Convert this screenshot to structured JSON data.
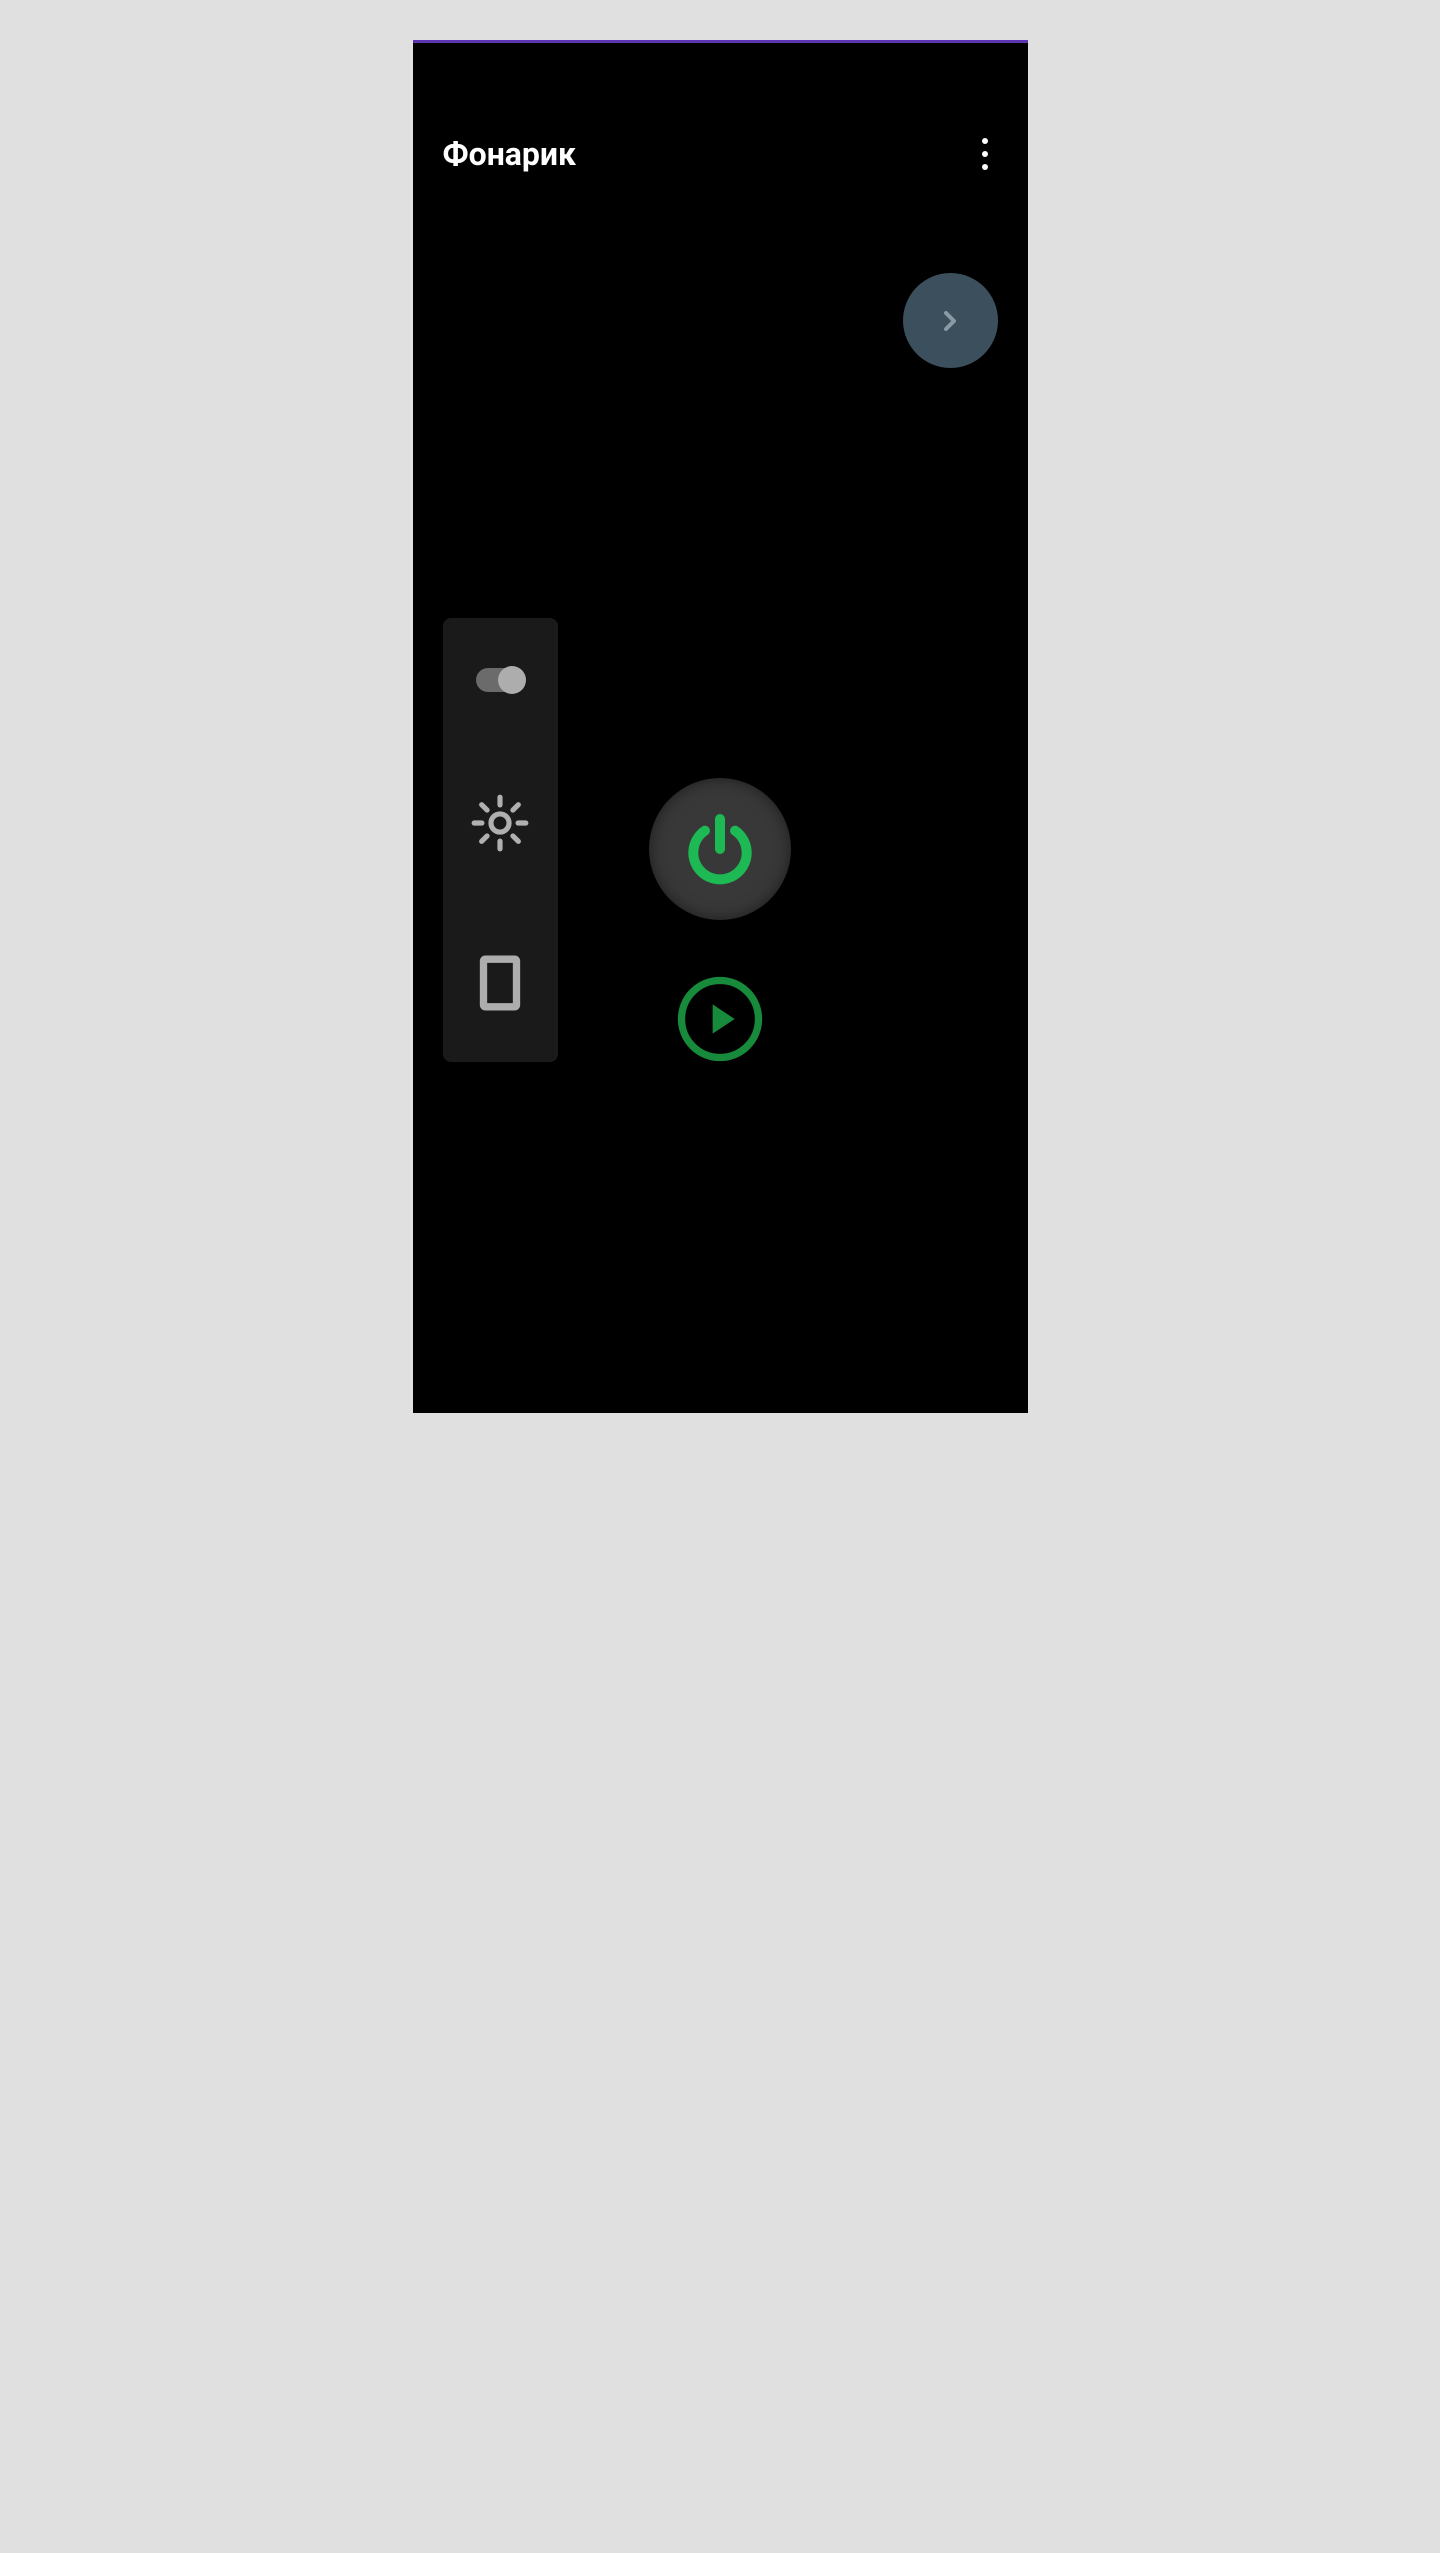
{
  "header": {
    "title": "Фонарик"
  },
  "colors": {
    "accent_green": "#1db954",
    "accent_green_dark": "#178a3c",
    "topbar": "#5e35b1",
    "panel": "#1a1a1a",
    "button_bg": "#383838",
    "next_bg": "#3c4f5c"
  }
}
